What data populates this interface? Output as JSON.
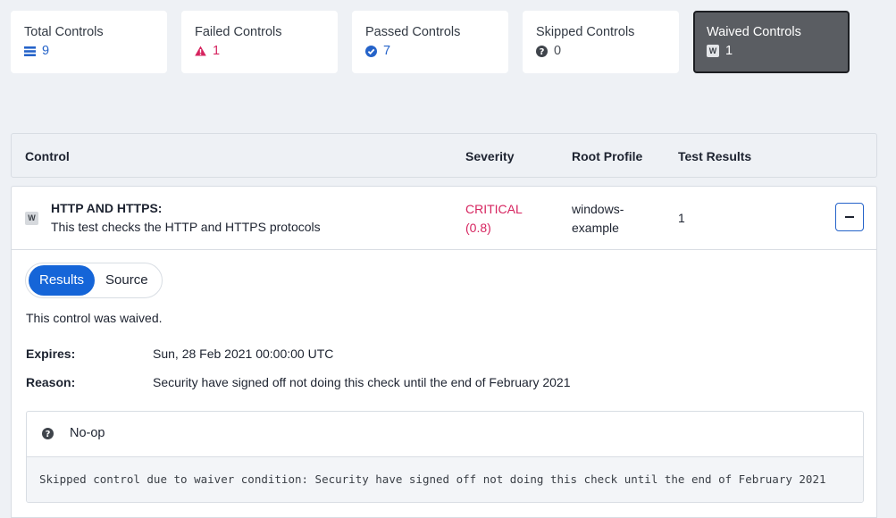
{
  "summary_cards": [
    {
      "title": "Total Controls",
      "count": "9",
      "icon": "list-icon",
      "color": "#2563c9"
    },
    {
      "title": "Failed Controls",
      "count": "1",
      "icon": "warning-triangle-icon",
      "color": "#d6245f"
    },
    {
      "title": "Passed Controls",
      "count": "7",
      "icon": "check-circle-icon",
      "color": "#2563c9"
    },
    {
      "title": "Skipped Controls",
      "count": "0",
      "icon": "question-circle-icon",
      "color": "#4a4f57"
    },
    {
      "title": "Waived Controls",
      "count": "1",
      "icon": "waived-badge-icon",
      "badge": "W",
      "active": true
    }
  ],
  "table": {
    "headers": {
      "control": "Control",
      "severity": "Severity",
      "root_profile": "Root Profile",
      "test_results": "Test Results"
    }
  },
  "row": {
    "badge": "W",
    "title": "HTTP AND HTTPS:",
    "description": "This test checks the HTTP and HTTPS protocols",
    "severity_line1": "CRITICAL",
    "severity_line2": "(0.8)",
    "root_profile_line1": "windows-",
    "root_profile_line2": "example",
    "test_results": "1",
    "severity_color": "#d6245f"
  },
  "detail": {
    "tabs": {
      "results": "Results",
      "source": "Source"
    },
    "waived_note": "This control was waived.",
    "expires_label": "Expires:",
    "expires_value": "Sun, 28 Feb 2021 00:00:00 UTC",
    "reason_label": "Reason:",
    "reason_value": "Security have signed off not doing this check until the end of February 2021",
    "result": {
      "icon": "question-circle-icon",
      "name": "No-op",
      "message": "Skipped control due to waiver condition: Security have signed off not doing this check until the end of February 2021"
    }
  },
  "colors": {
    "accent": "#1565d8",
    "failed": "#d6245f",
    "background": "#eef1f5"
  }
}
